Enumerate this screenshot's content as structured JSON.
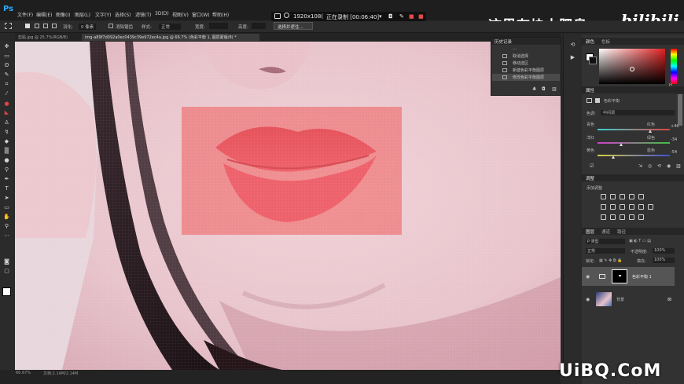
{
  "app": {
    "logo": "Ps"
  },
  "menu": [
    "文件(F)",
    "编辑(E)",
    "图像(I)",
    "图层(L)",
    "文字(Y)",
    "选择(S)",
    "滤镜(T)",
    "3D(D)",
    "视图(V)",
    "窗口(W)",
    "帮助(H)"
  ],
  "recorder": {
    "resolution": "1920x108(",
    "status": "正在录制 [00:06:40]"
  },
  "watermark": {
    "channel": "这里有块大肥皂",
    "bili": "bilibili",
    "site": "UiBQ.CoM"
  },
  "options": {
    "feather_label": "羽化:",
    "feather_value": "0 像素",
    "antialias": "消除锯齿",
    "style_label": "样式:",
    "style_value": "正常",
    "width_label": "宽度:",
    "height_label": "高度:",
    "select_button": "选择并遮住..."
  },
  "tabs": {
    "tab1": "剪贴.jpg @ 25.7%(RGB/8)",
    "tab2": "img-a89f7d092a0ec0439c39e972ec4a.jpg @ 66.7% (色彩平衡 1, 图层蒙版/8) *"
  },
  "history": {
    "title": "历史记录",
    "items": [
      {
        "label": "…"
      },
      {
        "label": "取消选择"
      },
      {
        "label": "移动选区"
      },
      {
        "label": "新建色彩平衡图层"
      },
      {
        "label": "修改色彩平衡图层"
      }
    ]
  },
  "color_panel": {
    "tabs": [
      "颜色",
      "色板"
    ],
    "hue_label": "H"
  },
  "properties": {
    "title": "属性",
    "subtitle": "色彩平衡",
    "tone_label": "色调:",
    "tone_value": "中间调",
    "sliders": [
      {
        "left": "青色",
        "right": "红色",
        "value": "+46",
        "pos": 0.73,
        "color": "#d24a4a"
      },
      {
        "left": "洋红",
        "right": "绿色",
        "value": "-34",
        "pos": 0.33,
        "color": "#4fb04f"
      },
      {
        "left": "黄色",
        "right": "蓝色",
        "value": "-54",
        "pos": 0.23,
        "color": "#4a5fd2"
      }
    ]
  },
  "adjustments": {
    "title": "调整",
    "add_label": "添加调整"
  },
  "layers": {
    "tabs": [
      "图层",
      "通道",
      "路径"
    ],
    "kind_label": "P 类型",
    "blend_mode": "正常",
    "opacity_label": "不透明度:",
    "opacity_value": "100%",
    "lock_label": "锁定:",
    "fill_label": "填充:",
    "fill_value": "100%",
    "items": [
      {
        "name": "色彩平衡 1"
      },
      {
        "name": "背景"
      }
    ]
  },
  "status": {
    "zoom": "66.67%",
    "doc": "文档:2.14M/2.14M"
  },
  "colors": {
    "accent": "#31a8ff",
    "selection": "#ef5a5a",
    "bg": "#282828"
  }
}
